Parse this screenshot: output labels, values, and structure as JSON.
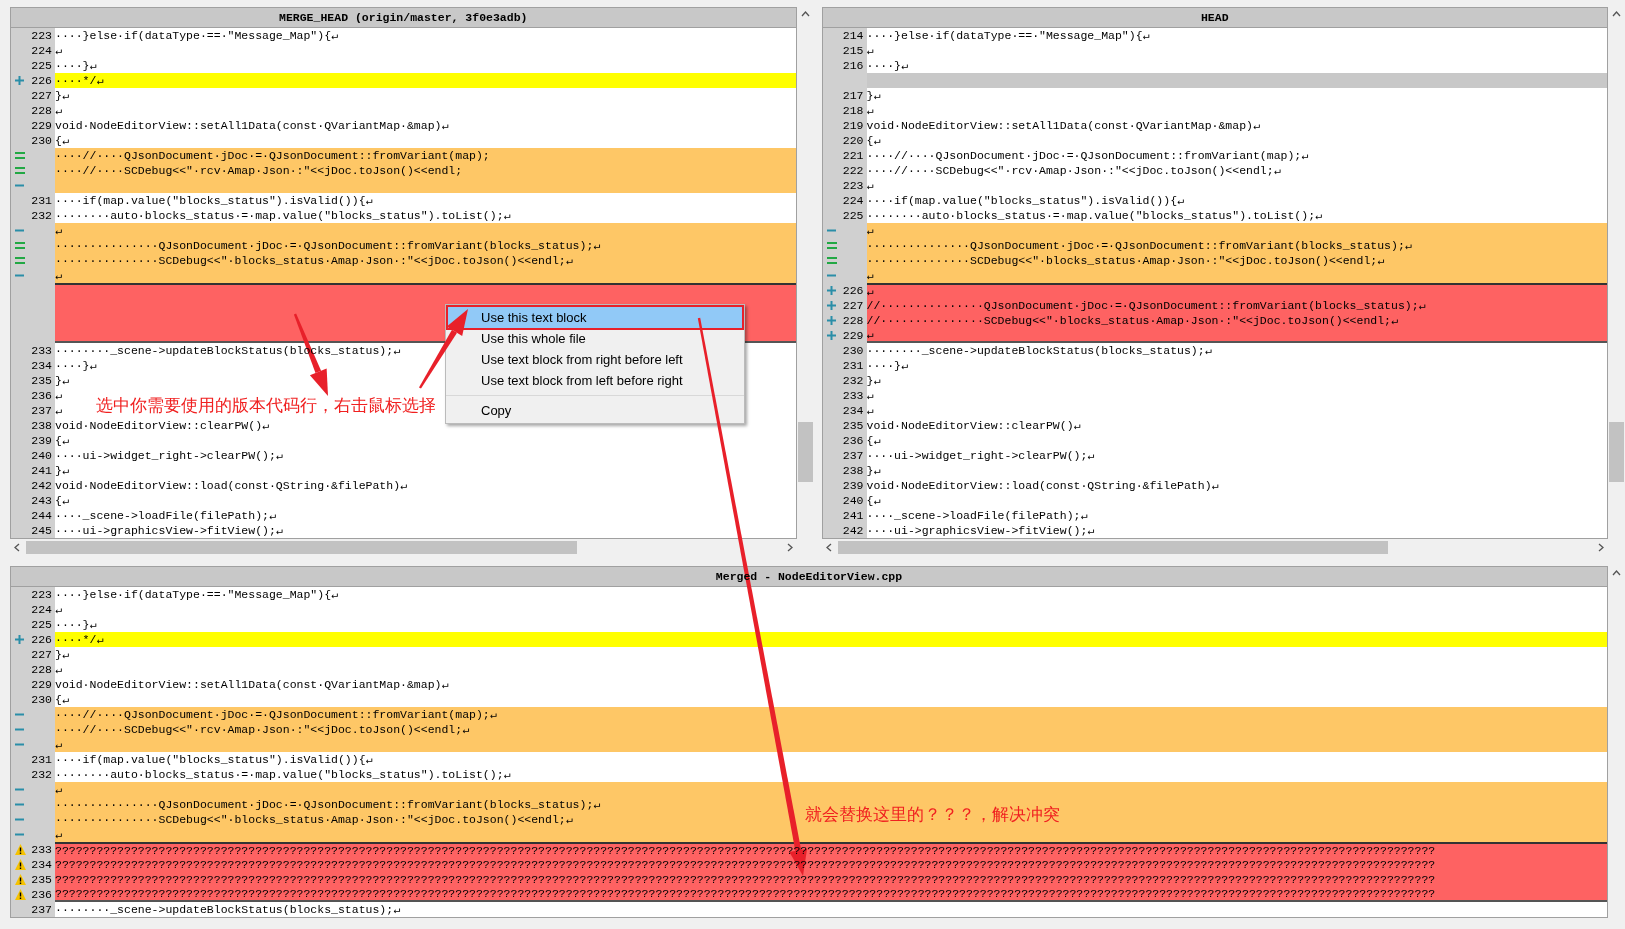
{
  "panes": [
    {
      "title": "MERGE_HEAD (origin/master, 3f0e3adb)",
      "lines": [
        {
          "kind": "normal",
          "num": "223",
          "text": "····}else·if(dataType·==·\"Message_Map\"){↵"
        },
        {
          "kind": "normal",
          "num": "224",
          "text": "↵"
        },
        {
          "kind": "normal",
          "num": "225",
          "text": "····}↵"
        },
        {
          "kind": "added",
          "marker": {
            "kind": "plus"
          },
          "num": "226",
          "text": "····*/↵"
        },
        {
          "kind": "normal",
          "num": "227",
          "text": "}↵"
        },
        {
          "kind": "normal",
          "num": "228",
          "text": "↵"
        },
        {
          "kind": "normal",
          "num": "229",
          "text": "void·NodeEditorView::setAll1Data(const·QVariantMap·&map)↵"
        },
        {
          "kind": "normal",
          "num": "230",
          "text": "{↵"
        },
        {
          "kind": "changed",
          "marker": {
            "kind": "equal"
          },
          "text": "····//····QJsonDocument·jDoc·=·QJsonDocument::fromVariant(map);"
        },
        {
          "kind": "changed",
          "marker": {
            "kind": "equal"
          },
          "text": "····//····SCDebug<<\"·rcv·Amap·Json·:\"<<jDoc.toJson()<<endl;"
        },
        {
          "kind": "changed",
          "marker": {
            "kind": "minus"
          }
        },
        {
          "kind": "normal",
          "num": "231",
          "text": "····if(map.value(\"blocks_status\").isValid()){↵"
        },
        {
          "kind": "normal",
          "num": "232",
          "text": "········auto·blocks_status·=·map.value(\"blocks_status\").toList();↵"
        },
        {
          "kind": "changed",
          "marker": {
            "kind": "minus"
          },
          "text": "↵"
        },
        {
          "kind": "changed",
          "marker": {
            "kind": "equal"
          },
          "text": "···············QJsonDocument·jDoc·=·QJsonDocument::fromVariant(blocks_status);↵"
        },
        {
          "kind": "changed",
          "marker": {
            "kind": "equal"
          },
          "text": "···············SCDebug<<\"·blocks_status·Amap·Json·:\"<<jDoc.toJson()<<endl;↵"
        },
        {
          "kind": "changed",
          "marker": {
            "kind": "minus"
          },
          "text": "↵"
        },
        {
          "kind": "conflict"
        },
        {
          "kind": "conflict"
        },
        {
          "kind": "conflict"
        },
        {
          "kind": "conflict"
        },
        {
          "kind": "normal",
          "num": "233",
          "text": "········_scene->updateBlockStatus(blocks_status);↵"
        },
        {
          "kind": "normal",
          "num": "234",
          "text": "····}↵"
        },
        {
          "kind": "normal",
          "num": "235",
          "text": "}↵"
        },
        {
          "kind": "normal",
          "num": "236",
          "text": "↵"
        },
        {
          "kind": "normal",
          "num": "237",
          "text": "↵"
        },
        {
          "kind": "normal",
          "num": "238",
          "text": "void·NodeEditorView::clearPW()↵"
        },
        {
          "kind": "normal",
          "num": "239",
          "text": "{↵"
        },
        {
          "kind": "normal",
          "num": "240",
          "text": "····ui->widget_right->clearPW();↵"
        },
        {
          "kind": "normal",
          "num": "241",
          "text": "}↵"
        },
        {
          "kind": "normal",
          "num": "242",
          "text": "void·NodeEditorView::load(const·QString·&filePath)↵"
        },
        {
          "kind": "normal",
          "num": "243",
          "text": "{↵"
        },
        {
          "kind": "normal",
          "num": "244",
          "text": "····_scene->loadFile(filePath);↵"
        },
        {
          "kind": "normal",
          "num": "245",
          "text": "····ui->graphicsView->fitView();↵"
        }
      ]
    },
    {
      "title": "HEAD",
      "lines": [
        {
          "kind": "normal",
          "num": "214",
          "text": "····}else·if(dataType·==·\"Message_Map\"){↵"
        },
        {
          "kind": "normal",
          "num": "215",
          "text": "↵"
        },
        {
          "kind": "normal",
          "num": "216",
          "text": "····}↵"
        },
        {
          "kind": "gap"
        },
        {
          "kind": "normal",
          "num": "217",
          "text": "}↵"
        },
        {
          "kind": "normal",
          "num": "218",
          "text": "↵"
        },
        {
          "kind": "normal",
          "num": "219",
          "text": "void·NodeEditorView::setAll1Data(const·QVariantMap·&map)↵"
        },
        {
          "kind": "normal",
          "num": "220",
          "text": "{↵"
        },
        {
          "kind": "normal",
          "num": "221",
          "text": "····//····QJsonDocument·jDoc·=·QJsonDocument::fromVariant(map);↵"
        },
        {
          "kind": "normal",
          "num": "222",
          "text": "····//····SCDebug<<\"·rcv·Amap·Json·:\"<<jDoc.toJson()<<endl;↵"
        },
        {
          "kind": "normal",
          "num": "223",
          "text": "↵"
        },
        {
          "kind": "normal",
          "num": "224",
          "text": "····if(map.value(\"blocks_status\").isValid()){↵"
        },
        {
          "kind": "normal",
          "num": "225",
          "text": "········auto·blocks_status·=·map.value(\"blocks_status\").toList();↵"
        },
        {
          "kind": "changed",
          "marker": {
            "kind": "minus"
          },
          "text": "↵"
        },
        {
          "kind": "changed",
          "marker": {
            "kind": "equal"
          },
          "text": "···············QJsonDocument·jDoc·=·QJsonDocument::fromVariant(blocks_status);↵"
        },
        {
          "kind": "changed",
          "marker": {
            "kind": "equal"
          },
          "text": "···············SCDebug<<\"·blocks_status·Amap·Json·:\"<<jDoc.toJson()<<endl;↵"
        },
        {
          "kind": "changed",
          "marker": {
            "kind": "minus"
          },
          "text": "↵"
        },
        {
          "kind": "conflict",
          "marker": {
            "kind": "plus"
          },
          "num": "226",
          "text": "↵"
        },
        {
          "kind": "conflict",
          "marker": {
            "kind": "plus"
          },
          "num": "227",
          "text": "//···············QJsonDocument·jDoc·=·QJsonDocument::fromVariant(blocks_status);↵"
        },
        {
          "kind": "conflict",
          "marker": {
            "kind": "plus"
          },
          "num": "228",
          "text": "//···············SCDebug<<\"·blocks_status·Amap·Json·:\"<<jDoc.toJson()<<endl;↵"
        },
        {
          "kind": "conflict",
          "marker": {
            "kind": "plus"
          },
          "num": "229",
          "text": "↵"
        },
        {
          "kind": "normal",
          "num": "230",
          "text": "········_scene->updateBlockStatus(blocks_status);↵"
        },
        {
          "kind": "normal",
          "num": "231",
          "text": "····}↵"
        },
        {
          "kind": "normal",
          "num": "232",
          "text": "}↵"
        },
        {
          "kind": "normal",
          "num": "233",
          "text": "↵"
        },
        {
          "kind": "normal",
          "num": "234",
          "text": "↵"
        },
        {
          "kind": "normal",
          "num": "235",
          "text": "void·NodeEditorView::clearPW()↵"
        },
        {
          "kind": "normal",
          "num": "236",
          "text": "{↵"
        },
        {
          "kind": "normal",
          "num": "237",
          "text": "····ui->widget_right->clearPW();↵"
        },
        {
          "kind": "normal",
          "num": "238",
          "text": "}↵"
        },
        {
          "kind": "normal",
          "num": "239",
          "text": "void·NodeEditorView::load(const·QString·&filePath)↵"
        },
        {
          "kind": "normal",
          "num": "240",
          "text": "{↵"
        },
        {
          "kind": "normal",
          "num": "241",
          "text": "····_scene->loadFile(filePath);↵"
        },
        {
          "kind": "normal",
          "num": "242",
          "text": "····ui->graphicsView->fitView();↵"
        }
      ]
    },
    {
      "title": "Merged - NodeEditorView.cpp",
      "lines": [
        {
          "kind": "normal",
          "num": "223",
          "text": "····}else·if(dataType·==·\"Message_Map\"){↵"
        },
        {
          "kind": "normal",
          "num": "224",
          "text": "↵"
        },
        {
          "kind": "normal",
          "num": "225",
          "text": "····}↵"
        },
        {
          "kind": "added",
          "marker": {
            "kind": "plus"
          },
          "num": "226",
          "text": "····*/↵"
        },
        {
          "kind": "normal",
          "num": "227",
          "text": "}↵"
        },
        {
          "kind": "normal",
          "num": "228",
          "text": "↵"
        },
        {
          "kind": "normal",
          "num": "229",
          "text": "void·NodeEditorView::setAll1Data(const·QVariantMap·&map)↵"
        },
        {
          "kind": "normal",
          "num": "230",
          "text": "{↵"
        },
        {
          "kind": "changed",
          "marker": {
            "kind": "minus"
          },
          "text": "····//····QJsonDocument·jDoc·=·QJsonDocument::fromVariant(map);↵"
        },
        {
          "kind": "changed",
          "marker": {
            "kind": "minus"
          },
          "text": "····//····SCDebug<<\"·rcv·Amap·Json·:\"<<jDoc.toJson()<<endl;↵"
        },
        {
          "kind": "changed",
          "marker": {
            "kind": "minus"
          },
          "text": "↵"
        },
        {
          "kind": "normal",
          "num": "231",
          "text": "····if(map.value(\"blocks_status\").isValid()){↵"
        },
        {
          "kind": "normal",
          "num": "232",
          "text": "········auto·blocks_status·=·map.value(\"blocks_status\").toList();↵"
        },
        {
          "kind": "changed",
          "marker": {
            "kind": "minus"
          },
          "text": "↵"
        },
        {
          "kind": "changed",
          "marker": {
            "kind": "minus"
          },
          "text": "···············QJsonDocument·jDoc·=·QJsonDocument::fromVariant(blocks_status);↵"
        },
        {
          "kind": "changed",
          "marker": {
            "kind": "minus"
          },
          "text": "···············SCDebug<<\"·blocks_status·Amap·Json·:\"<<jDoc.toJson()<<endl;↵"
        },
        {
          "kind": "changed",
          "marker": {
            "kind": "minus"
          },
          "text": "↵"
        },
        {
          "kind": "conflict",
          "marker": {
            "kind": "warning"
          },
          "num": "233",
          "text": "????????????????????????????????????????????????????????????????????????????????????????????????????????????????????????????????????????????????????????????????????????????????????????????????????????"
        },
        {
          "kind": "conflict",
          "marker": {
            "kind": "warning"
          },
          "num": "234",
          "text": "????????????????????????????????????????????????????????????????????????????????????????????????????????????????????????????????????????????????????????????????????????????????????????????????????????"
        },
        {
          "kind": "conflict",
          "marker": {
            "kind": "warning"
          },
          "num": "235",
          "text": "????????????????????????????????????????????????????????????????????????????????????????????????????????????????????????????????????????????????????????????????????????????????????????????????????????"
        },
        {
          "kind": "conflict",
          "marker": {
            "kind": "warning"
          },
          "num": "236",
          "text": "????????????????????????????????????????????????????????????????????????????????????????????????????????????????????????????????????????????????????????????????????????????????????????????????????????"
        },
        {
          "kind": "normal",
          "num": "237",
          "text": "········_scene->updateBlockStatus(blocks_status);↵"
        }
      ]
    }
  ],
  "context_menu": {
    "groups": [
      [
        {
          "label": "Use this text block",
          "selected": true
        },
        {
          "label": "Use this whole file",
          "selected": false
        },
        {
          "label": "Use text block from right before left",
          "selected": false
        },
        {
          "label": "Use text block from left before right",
          "selected": false
        }
      ],
      [
        {
          "label": "Copy",
          "selected": false
        }
      ]
    ]
  },
  "annotations": [
    {
      "text": "选中你需要使用的版本代码行，右击鼠标选择"
    },
    {
      "text": "就会替换这里的？？？，解决冲突"
    }
  ]
}
